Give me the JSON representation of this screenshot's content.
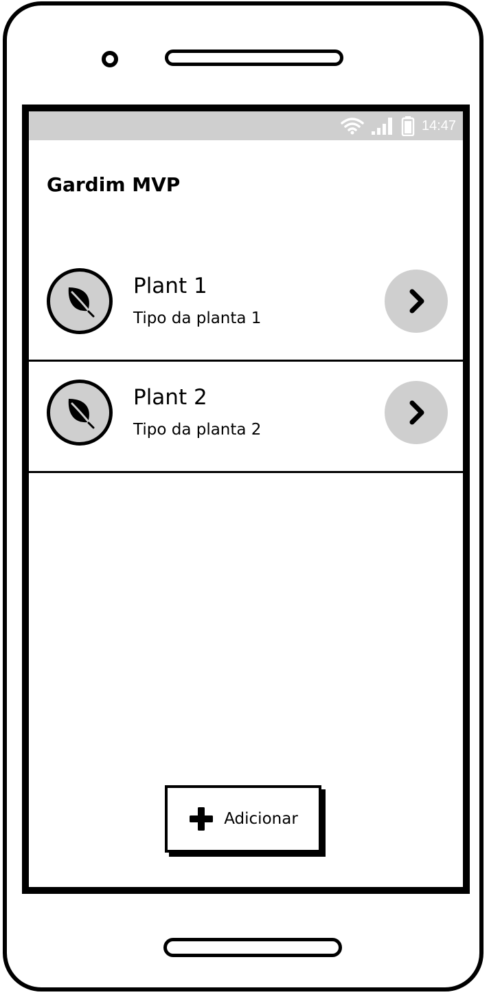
{
  "status_bar": {
    "time": "14:47",
    "icons": [
      "wifi-icon",
      "signal-icon",
      "battery-icon"
    ]
  },
  "app": {
    "title": "Gardim MVP"
  },
  "plants": [
    {
      "name": "Plant 1",
      "type": "Tipo da planta 1",
      "icon": "leaf-icon"
    },
    {
      "name": "Plant 2",
      "type": "Tipo da planta 2",
      "icon": "leaf-icon"
    }
  ],
  "add_button": {
    "label": "Adicionar",
    "icon": "plus-icon"
  },
  "colors": {
    "status_bar_bg": "#cfcfcf",
    "avatar_bg": "#cfcfcf",
    "chevron_bg": "#cfcfcf",
    "ink": "#000000"
  }
}
